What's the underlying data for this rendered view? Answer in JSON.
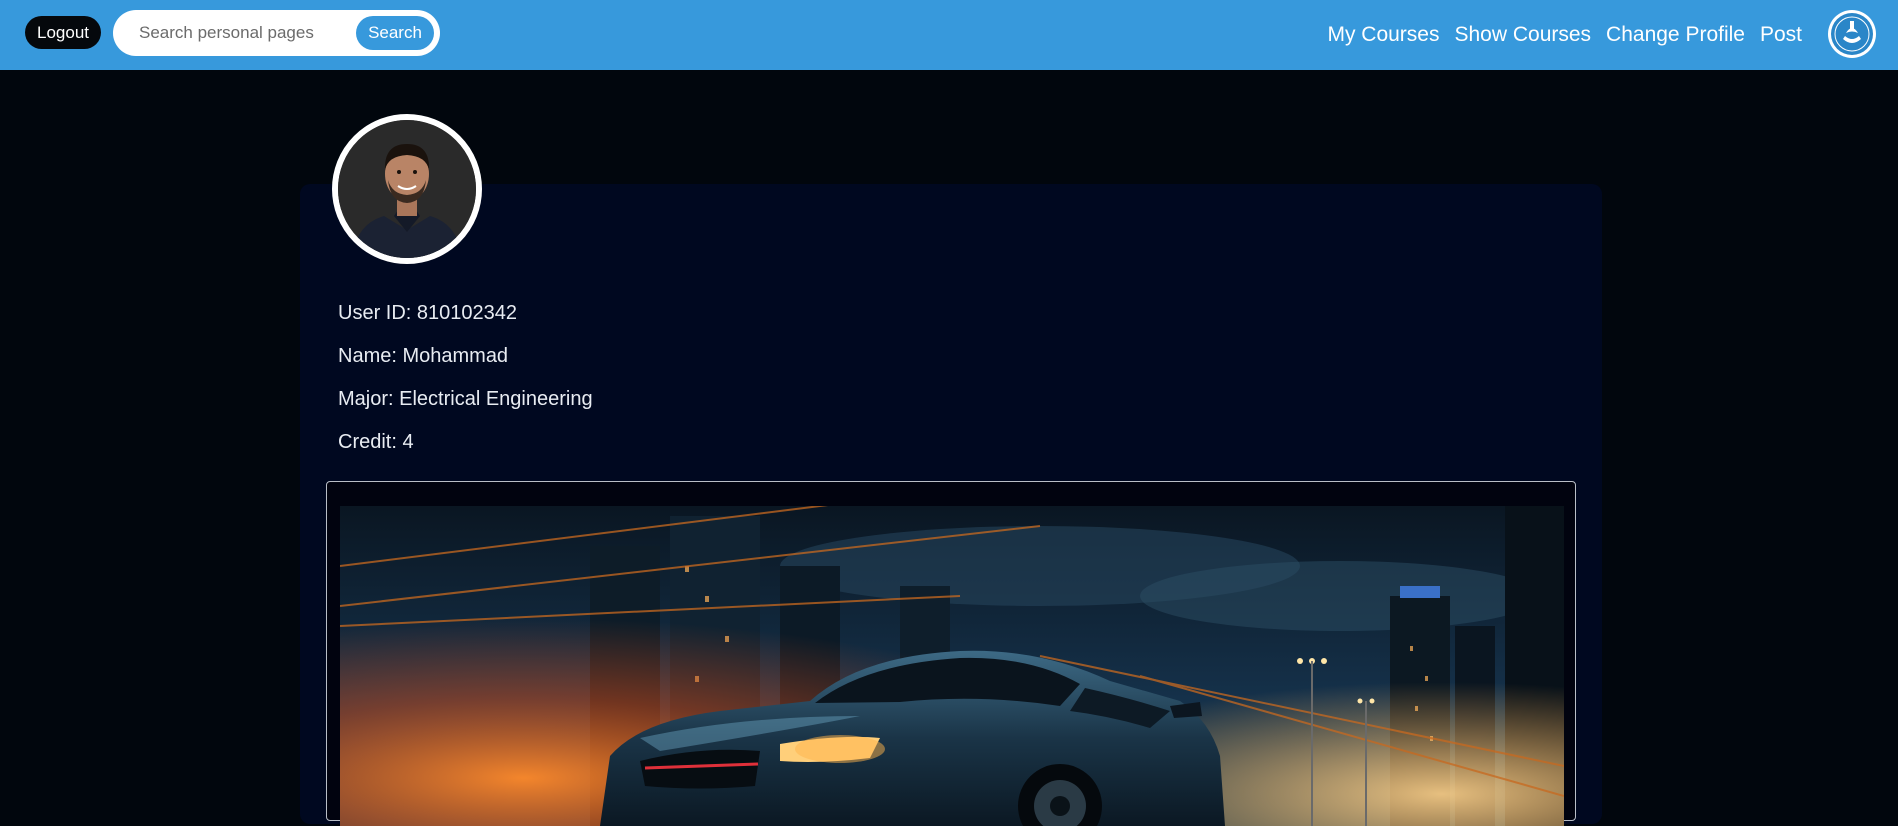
{
  "navbar": {
    "logout_label": "Logout",
    "search_placeholder": "Search personal pages",
    "search_button_label": "Search",
    "links": [
      "My Courses",
      "Show Courses",
      "Change Profile",
      "Post"
    ],
    "logo_icon": "university-seal-icon",
    "bg_color": "#3799dc"
  },
  "profile": {
    "avatar_icon": "user-avatar-photo",
    "user_id": "User ID: 810102342",
    "name": "Name: Mohammad",
    "major": "Major: Electrical Engineering",
    "credit": "Credit: 4"
  },
  "post": {
    "image_icon": "sports-car-night-city-photo"
  }
}
